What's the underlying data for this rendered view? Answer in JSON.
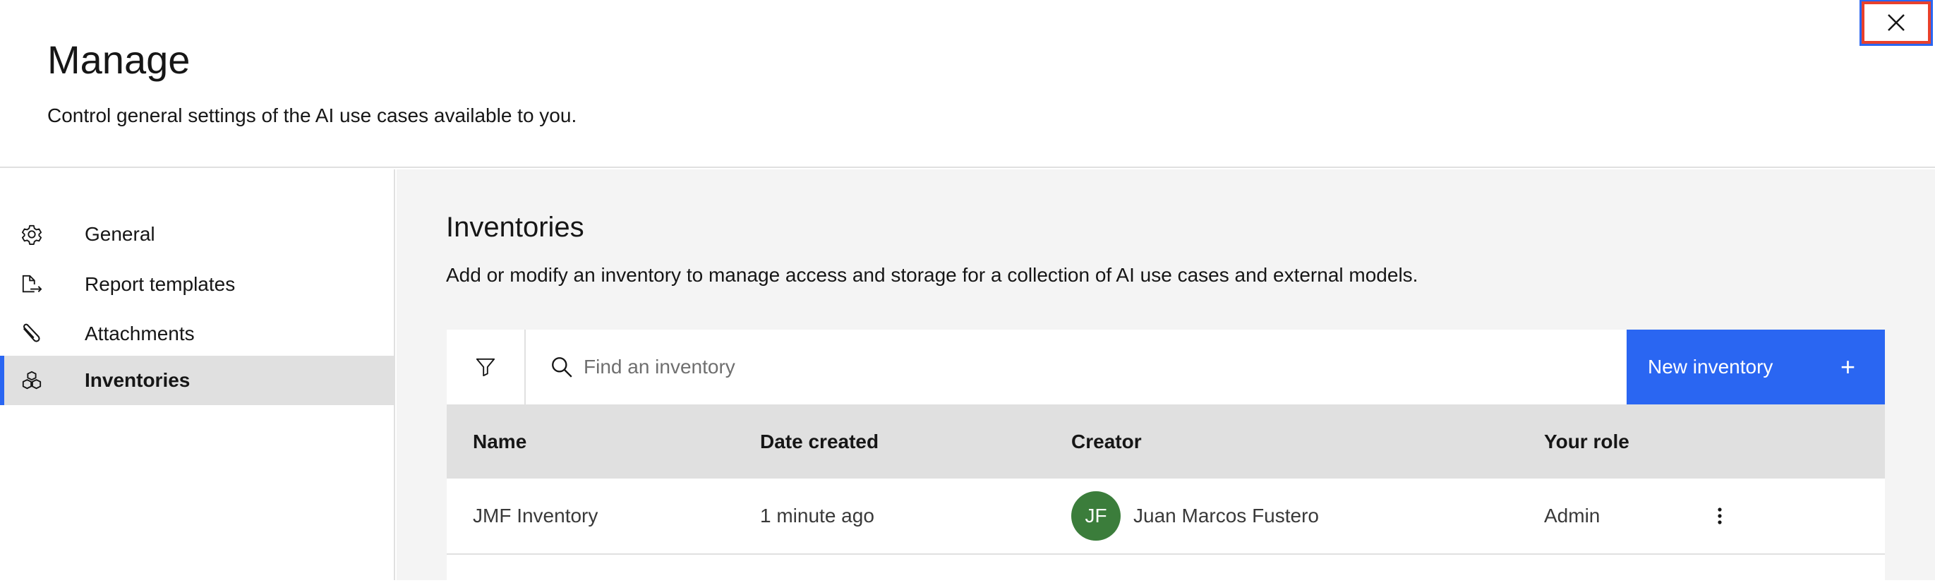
{
  "header": {
    "title": "Manage",
    "subtitle": "Control general settings of the AI use cases available to you."
  },
  "sidebar": {
    "items": [
      {
        "label": "General",
        "icon": "gear-icon"
      },
      {
        "label": "Report templates",
        "icon": "document-export-icon"
      },
      {
        "label": "Attachments",
        "icon": "paperclip-icon"
      },
      {
        "label": "Inventories",
        "icon": "cubes-icon",
        "active": true
      }
    ]
  },
  "main": {
    "title": "Inventories",
    "description": "Add or modify an inventory to manage access and storage for a collection of AI use cases and external models.",
    "search_placeholder": "Find an inventory",
    "new_button": "New inventory",
    "new_button_icon": "+",
    "table": {
      "columns": [
        "Name",
        "Date created",
        "Creator",
        "Your role"
      ],
      "rows": [
        {
          "name": "JMF Inventory",
          "date": "1 minute ago",
          "creator_initials": "JF",
          "creator": "Juan Marcos Fustero",
          "role": "Admin"
        }
      ]
    }
  },
  "colors": {
    "accent": "#2a66f2",
    "avatar": "#3b7d3b",
    "highlight": "#e8412c"
  }
}
